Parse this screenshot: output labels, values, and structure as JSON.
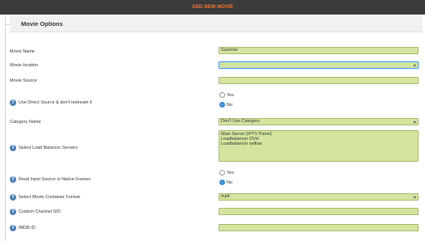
{
  "header": {
    "add_button_label": "ADD NEW MOVIE"
  },
  "panel": {
    "title": "Movie Options"
  },
  "fields": {
    "movie_name": {
      "label": "Movie Name",
      "value": "Summer"
    },
    "movie_location": {
      "label": "Movie location",
      "value": "-"
    },
    "movie_source": {
      "label": "Movie Source",
      "value": ""
    },
    "direct_source": {
      "label": "Use Direct Source & don't restream it",
      "options": [
        "Yes",
        "No"
      ],
      "selected": "No"
    },
    "category_name": {
      "label": "Category Name",
      "value": "Don't Use Category"
    },
    "load_balancer": {
      "label": "Select Load Balancer Servers",
      "options": [
        "Main Server (IPTV Panel)",
        "Loadbalancer OVH",
        "Loadbalancer selfow"
      ]
    },
    "native_frames": {
      "label": "Read Input Source in Native Frames",
      "options": [
        "Yes",
        "No"
      ],
      "selected": "No"
    },
    "container_format": {
      "label": "Select Movie Container Format",
      "value": "mp4"
    },
    "custom_sid": {
      "label": "Custom Channel SID",
      "value": ""
    },
    "imdb_id": {
      "label": "IMDB ID",
      "value": ""
    }
  },
  "colors": {
    "accent_orange": "#f47a3c",
    "field_bg": "#d4e59f",
    "help_icon": "#4a7fb5",
    "radio_on": "#3b8fd6"
  },
  "icons": {
    "help": "question-circle-icon"
  }
}
